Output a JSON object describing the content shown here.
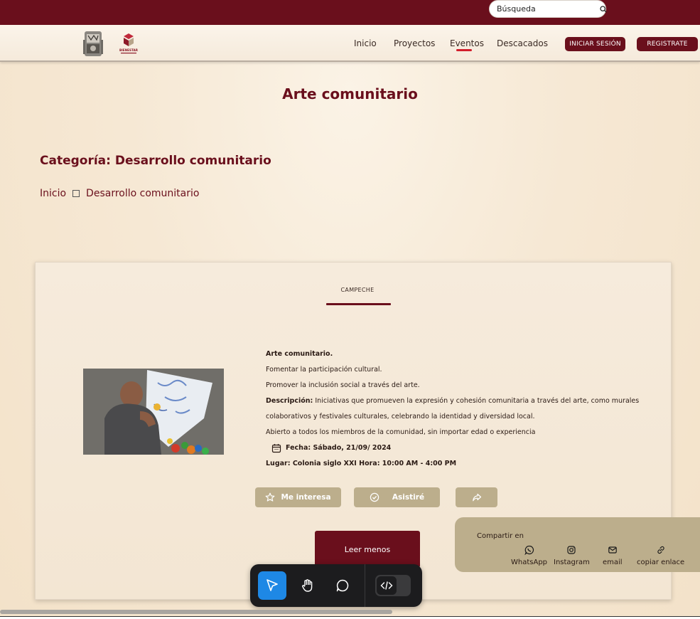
{
  "header": {
    "search_placeholder": "Búsqueda"
  },
  "nav": {
    "items": [
      "Inicio",
      "Proyectos",
      "Eventos",
      "Descacados"
    ],
    "active": "Eventos",
    "login_label": "INICIAR SESIÓN",
    "register_label": "REGISTRATE",
    "logo2_text": "BIENESTAR"
  },
  "page": {
    "title": "Arte comunitario",
    "category": "Categoría: Desarrollo comunitario",
    "breadcrumb": [
      "Inicio",
      "Desarrollo comunitario"
    ]
  },
  "event": {
    "state": "CAMPECHE",
    "name": "Arte comunitario.",
    "line1": "Fomentar la participación cultural.",
    "line2": "Promover la inclusión social a través del arte.",
    "description_label": "Descripción:",
    "description_a": " Iniciativas que promueven la expresión y cohesión comunitaria a través del arte, como murales",
    "description_b": "colaborativos y festivales culturales, celebrando la identidad y diversidad local.",
    "audience": "Abierto a todos los miembros de la comunidad, sin importar edad o experiencia",
    "date": "Fecha: Sábado, 21/09/ 2024",
    "place": "Lugar: Colonia siglo XXI Hora: 10:00 AM - 4:00 PM",
    "interest_label": "Me interesa",
    "attend_label": "Asistiré",
    "read_less_label": "Leer menos"
  },
  "share": {
    "label": "Compartir en",
    "items": [
      "WhatsApp",
      "Instagram",
      "email",
      "copiar enlace"
    ]
  },
  "colors": {
    "brand": "#6a0f1c",
    "accent": "#bcae8c",
    "active_underline": "#d21e2b",
    "tool_active": "#1e88e5"
  },
  "toolbar": {
    "tools": [
      "pointer-icon",
      "hand-icon",
      "comment-icon",
      "code-icon"
    ],
    "active_tool": "pointer-icon"
  }
}
